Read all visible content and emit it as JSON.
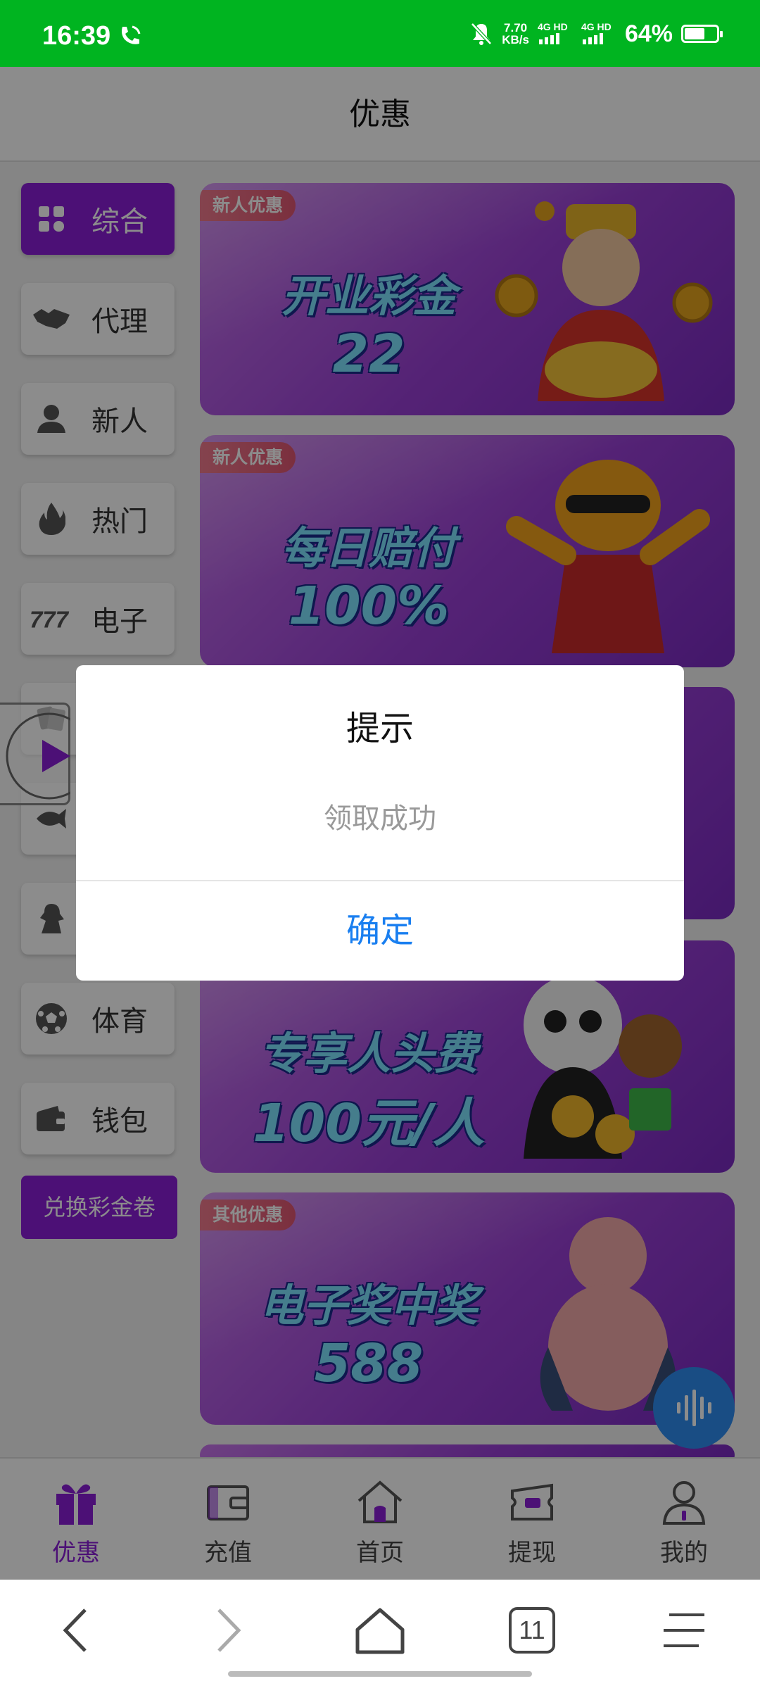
{
  "status_bar": {
    "time": "16:39",
    "net_speed_value": "7.70",
    "net_speed_unit": "KB/s",
    "network1": "4G HD",
    "network2": "4G HD",
    "battery_percent": "64%",
    "battery_level": 0.64
  },
  "header": {
    "title": "优惠"
  },
  "sidebar": {
    "items": [
      {
        "label": "综合",
        "icon": "grid-icon",
        "active": true
      },
      {
        "label": "代理",
        "icon": "handshake-icon",
        "active": false
      },
      {
        "label": "新人",
        "icon": "person-icon",
        "active": false
      },
      {
        "label": "热门",
        "icon": "flame-icon",
        "active": false
      },
      {
        "label": "电子",
        "icon": "slot-777-icon",
        "active": false
      },
      {
        "label": "",
        "icon": "cards-icon",
        "active": false
      },
      {
        "label": "",
        "icon": "fish-icon",
        "active": false
      },
      {
        "label": "",
        "icon": "ninja-icon",
        "active": false
      },
      {
        "label": "体育",
        "icon": "soccer-ball-icon",
        "active": false
      },
      {
        "label": "钱包",
        "icon": "wallet-icon",
        "active": false
      }
    ],
    "exchange_button": "兑换彩金卷"
  },
  "banners": [
    {
      "tag": "新人优惠",
      "line1": "开业彩金",
      "line2": "22"
    },
    {
      "tag": "新人优惠",
      "line1": "每日赔付",
      "line2": "100%"
    },
    {
      "tag": "",
      "line1": "",
      "line2": ""
    },
    {
      "tag": "",
      "line1": "专享人头费",
      "line2": "100元/人"
    },
    {
      "tag": "其他优惠",
      "line1": "电子奖中奖",
      "line2": "588"
    }
  ],
  "tabbar": [
    {
      "label": "优惠",
      "icon": "gift-icon",
      "active": true
    },
    {
      "label": "充值",
      "icon": "wallet-icon",
      "active": false
    },
    {
      "label": "首页",
      "icon": "home-icon",
      "active": false
    },
    {
      "label": "提现",
      "icon": "withdraw-icon",
      "active": false
    },
    {
      "label": "我的",
      "icon": "user-icon",
      "active": false
    }
  ],
  "browser_nav": {
    "tab_count": "11"
  },
  "dialog": {
    "title": "提示",
    "message": "领取成功",
    "confirm": "确定"
  },
  "colors": {
    "status_bar": "#00b420",
    "accent": "#8a1ed8",
    "link_blue": "#1a7ff0"
  }
}
